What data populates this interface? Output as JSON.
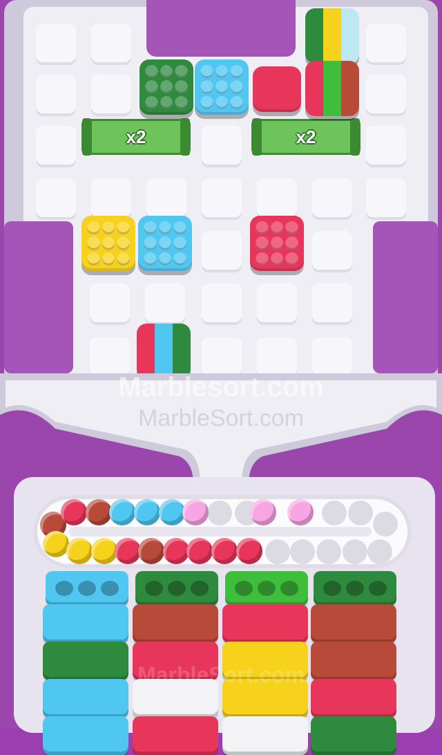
{
  "board": {
    "multipliers": [
      {
        "label": "x2"
      },
      {
        "label": "x2"
      }
    ]
  },
  "blocks": [
    {
      "name": "block-dark-green",
      "color": "#2e8a3c"
    },
    {
      "name": "block-cyan",
      "color": "#4fc7f0"
    },
    {
      "name": "block-crimson",
      "color": "#e8365a"
    },
    {
      "name": "block-striped-top",
      "colors": [
        "#2e8a3c",
        "#f6d21c",
        "#bde8f2"
      ]
    },
    {
      "name": "block-striped-right",
      "colors": [
        "#e8365a",
        "#3fbe3c",
        "#b84a3a"
      ]
    },
    {
      "name": "block-yellow",
      "color": "#f6d21c"
    },
    {
      "name": "block-cyan-2",
      "color": "#4fc7f0"
    },
    {
      "name": "block-crimson-2",
      "color": "#e8365a"
    },
    {
      "name": "block-striped-bottom",
      "colors": [
        "#e8365a",
        "#4fc7f0",
        "#2e8a3c"
      ]
    }
  ],
  "watermarks": {
    "primary": "Marblesort.com",
    "secondary": "MarbleSort.com",
    "faded": "MarbleSort.com"
  },
  "track": {
    "marbles_top": [
      "#b84a3a",
      "#e8365a",
      "#b84a3a",
      "#4fc7f0",
      "#4fc7f0",
      "#4fc7f0",
      "#f7a6e3",
      "#f7a6e3",
      "#f7a6e3"
    ],
    "marbles_bottom": [
      "#f6d21c",
      "#f6d21c",
      "#f6d21c",
      "#e8365a",
      "#b84a3a",
      "#e8365a",
      "#e8365a",
      "#e8365a",
      "#e8365a"
    ]
  },
  "tubes": [
    {
      "name": "tube-cyan",
      "top": "#4fc7f0",
      "rows": [
        "#4fc7f0",
        "#2e8a3c",
        "#4fc7f0",
        "#4fc7f0"
      ]
    },
    {
      "name": "tube-dark-green",
      "top": "#2e8a3c",
      "rows": [
        "#b84a3a",
        "#e8365a",
        "#f3f3f6",
        "#e8365a"
      ]
    },
    {
      "name": "tube-light-green",
      "top": "#3fbe3c",
      "rows": [
        "#e8365a",
        "#f6d21c",
        "#f6d21c",
        "#f3f3f6"
      ]
    },
    {
      "name": "tube-dark-green-2",
      "top": "#2e8a3c",
      "rows": [
        "#b84a3a",
        "#b84a3a",
        "#e8365a",
        "#2e8a3c"
      ]
    }
  ]
}
